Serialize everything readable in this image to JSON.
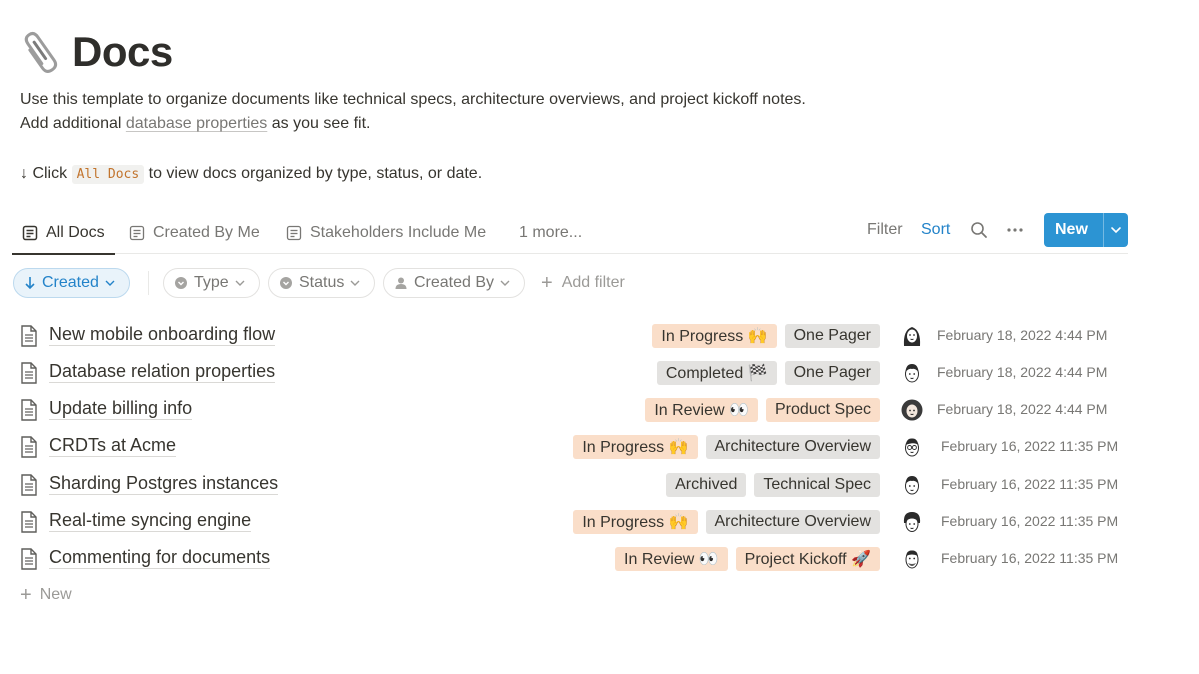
{
  "page": {
    "title": "Docs",
    "icon": "paperclip-icon",
    "description_line1": "Use this template to organize documents like technical specs, architecture overviews, and project kickoff notes.",
    "description_line2_prefix": "Add additional ",
    "description_line2_link": "database properties",
    "description_line2_suffix": " as you see fit.",
    "hint_prefix": "↓ Click ",
    "hint_code": "All Docs",
    "hint_suffix": " to view docs organized by type, status, or date."
  },
  "views": {
    "tabs": [
      {
        "label": "All Docs",
        "active": true,
        "icon": "list-view-icon"
      },
      {
        "label": "Created By Me",
        "active": false,
        "icon": "list-view-icon"
      },
      {
        "label": "Stakeholders Include Me",
        "active": false,
        "icon": "list-view-icon"
      }
    ],
    "more_label": "1 more...",
    "filter_label": "Filter",
    "sort_label": "Sort",
    "new_label": "New"
  },
  "filters": {
    "sort_chip": "Created",
    "chips": [
      "Type",
      "Status",
      "Created By"
    ],
    "add_filter": "Add filter"
  },
  "docs": [
    {
      "title": "New mobile onboarding flow",
      "status": "In Progress 🙌",
      "status_color": "orange",
      "type": "One Pager",
      "type_color": "gray",
      "date": "February 18, 2022 4:44 PM",
      "avatar": "avatar-woman-long-hair-icon"
    },
    {
      "title": "Database relation properties",
      "status": "Completed 🏁",
      "status_color": "gray",
      "type": "One Pager",
      "type_color": "gray",
      "date": "February 18, 2022 4:44 PM",
      "avatar": "avatar-man-icon"
    },
    {
      "title": "Update billing info",
      "status": "In Review 👀",
      "status_color": "orange",
      "type": "Product Spec",
      "type_color": "orange",
      "date": "February 18, 2022 4:44 PM",
      "avatar": "avatar-woman-curly-hair-icon"
    },
    {
      "title": "CRDTs at Acme",
      "status": "In Progress 🙌",
      "status_color": "orange",
      "type": "Architecture Overview",
      "type_color": "gray",
      "date": "February 16, 2022 11:35 PM",
      "avatar": "avatar-man-glasses-icon"
    },
    {
      "title": "Sharding Postgres instances",
      "status": "Archived",
      "status_color": "gray",
      "type": "Technical Spec",
      "type_color": "gray",
      "date": "February 16, 2022 11:35 PM",
      "avatar": "avatar-man-icon"
    },
    {
      "title": "Real-time syncing engine",
      "status": "In Progress 🙌",
      "status_color": "orange",
      "type": "Architecture Overview",
      "type_color": "gray",
      "date": "February 16, 2022 11:35 PM",
      "avatar": "avatar-man-dark-hair-icon"
    },
    {
      "title": "Commenting for documents",
      "status": "In Review 👀",
      "status_color": "orange",
      "type": "Project Kickoff 🚀",
      "type_color": "orange",
      "date": "February 16, 2022 11:35 PM",
      "avatar": "avatar-man-beard-icon"
    }
  ],
  "add_row_label": "New",
  "colors": {
    "accent": "#2383c9",
    "new_button": "#2c94d3",
    "tag_orange": "#fadec9",
    "tag_gray": "#e3e2e0",
    "code_text": "#c2742d"
  }
}
